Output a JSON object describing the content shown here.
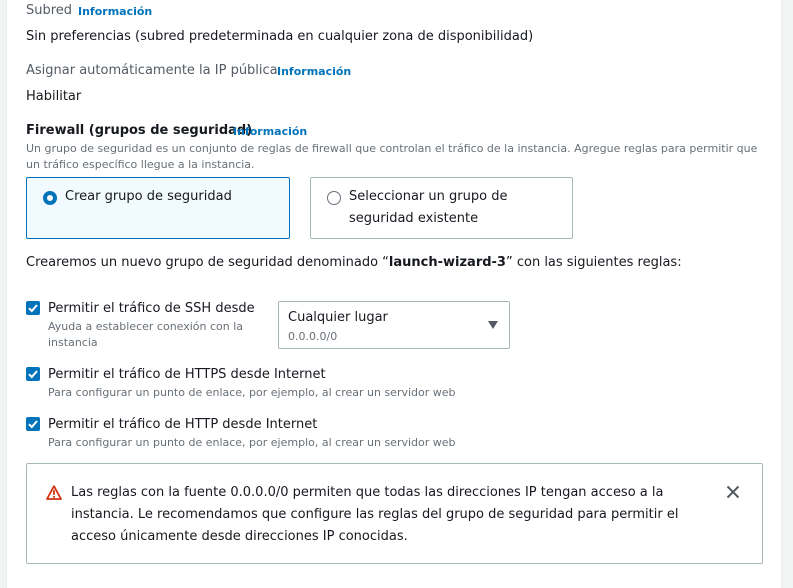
{
  "subnet": {
    "label": "Subred",
    "info": "Información",
    "value": "Sin preferencias (subred predeterminada en cualquier zona de disponibilidad)"
  },
  "public_ip": {
    "label": "Asignar automáticamente la IP pública",
    "info": "Información",
    "value": "Habilitar"
  },
  "firewall": {
    "heading": "Firewall (grupos de seguridad)",
    "info": "Información",
    "description": "Un grupo de seguridad es un conjunto de reglas de firewall que controlan el tráfico de la instancia. Agregue reglas para permitir que un tráfico específico llegue a la instancia.",
    "options": [
      {
        "label": "Crear grupo de seguridad",
        "selected": true
      },
      {
        "label_line1": "Seleccionar un grupo de",
        "label_line2": "seguridad existente",
        "selected": false
      }
    ]
  },
  "new_group": {
    "prefix": "Crearemos un nuevo grupo de seguridad denominado “",
    "name": "launch-wizard-3",
    "suffix": "” con las siguientes reglas:"
  },
  "rules": [
    {
      "label": "Permitir el tráfico de SSH desde",
      "description": "Ayuda a establecer conexión con la instancia",
      "checked": true
    },
    {
      "label": "Permitir el tráfico de HTTPS desde Internet",
      "description": "Para configurar un punto de enlace, por ejemplo, al crear un servidor web",
      "checked": true
    },
    {
      "label": "Permitir el tráfico de HTTP desde Internet",
      "description": "Para configurar un punto de enlace, por ejemplo, al crear un servidor web",
      "checked": true
    }
  ],
  "ssh_source_select": {
    "selected": "Cualquier lugar",
    "detail": "0.0.0.0/0"
  },
  "warning": {
    "text": "Las reglas con la fuente 0.0.0.0/0 permiten que todas las direcciones IP tengan acceso a la instancia. Le recomendamos que configure las reglas del grupo de seguridad para permitir el acceso únicamente desde direcciones IP conocidas.",
    "color": "#d13212"
  },
  "colors": {
    "accent": "#0073bb",
    "text": "#16191f",
    "muted": "#687078"
  }
}
